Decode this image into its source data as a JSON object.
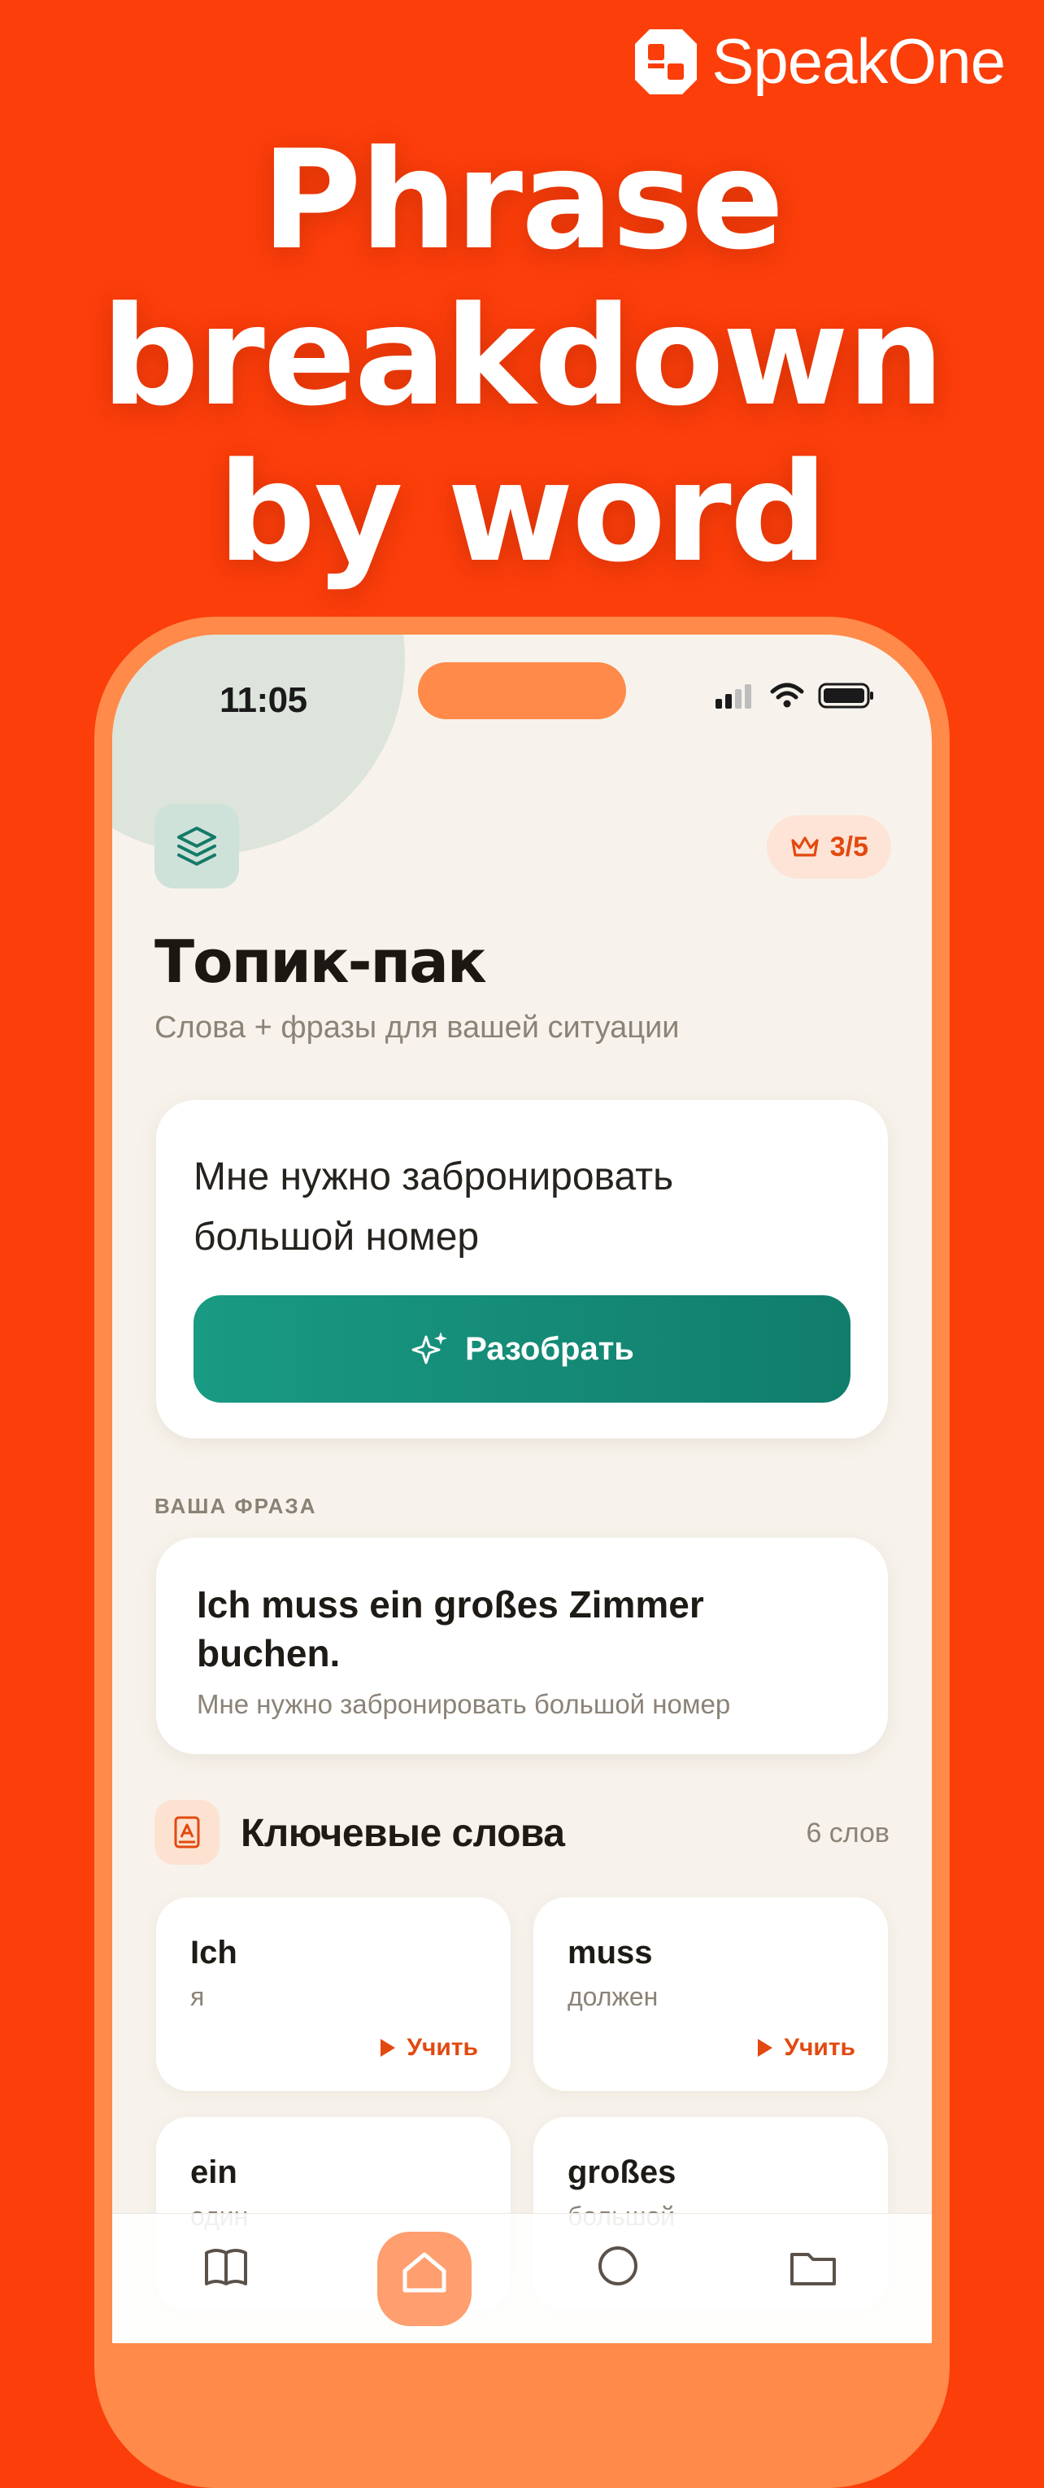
{
  "brand": {
    "name": "SpeakOne",
    "logo_icon": "speakone-logo-icon"
  },
  "headline": [
    "Phrase",
    "breakdown",
    "by word"
  ],
  "status_bar": {
    "time": "11:05"
  },
  "header": {
    "limit": "3/5",
    "limit_icon": "crown-icon",
    "stack_icon": "layers-icon"
  },
  "page": {
    "title": "Топик-пак",
    "subtitle": "Слова + фразы для вашей ситуации"
  },
  "input_card": {
    "text": "Мне нужно забронировать большой номер",
    "button_label": "Разобрать",
    "button_icon": "sparkles-icon"
  },
  "phrase_section": {
    "label": "ВАША ФРАЗА",
    "german": "Ich muss ein großes Zimmer buchen.",
    "russian": "Мне нужно забронировать большой номер"
  },
  "keywords": {
    "title": "Ключевые слова",
    "count": "6 слов",
    "learn_label": "Учить",
    "items": [
      {
        "word": "Ich",
        "translation": "я"
      },
      {
        "word": "muss",
        "translation": "должен"
      },
      {
        "word": "ein",
        "translation": "один"
      },
      {
        "word": "großes",
        "translation": "большой"
      }
    ]
  },
  "tabbar": {
    "icons": [
      "book-icon",
      "home-icon",
      "chat-icon",
      "folder-icon"
    ],
    "active_index": 1
  },
  "colors": {
    "background": "#fb3e0a",
    "accent": "#e2490f",
    "teal": "#148b77",
    "phone_frame": "#ff8a4a"
  }
}
